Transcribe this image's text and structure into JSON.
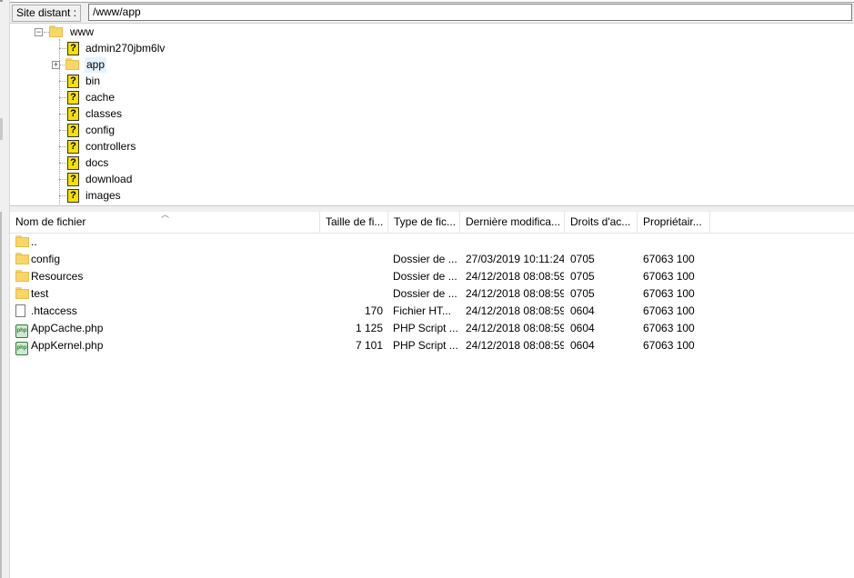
{
  "address": {
    "label": "Site distant :",
    "path": "/www/app"
  },
  "tree": {
    "root": "www",
    "items": [
      {
        "label": "admin270jbm6lv",
        "icon": "question-icon"
      },
      {
        "label": "app",
        "icon": "folder-icon",
        "selected": true,
        "expander": "+"
      },
      {
        "label": "bin",
        "icon": "question-icon"
      },
      {
        "label": "cache",
        "icon": "question-icon"
      },
      {
        "label": "classes",
        "icon": "question-icon"
      },
      {
        "label": "config",
        "icon": "question-icon"
      },
      {
        "label": "controllers",
        "icon": "question-icon"
      },
      {
        "label": "docs",
        "icon": "question-icon"
      },
      {
        "label": "download",
        "icon": "question-icon"
      },
      {
        "label": "images",
        "icon": "question-icon"
      }
    ]
  },
  "list": {
    "columns": [
      "Nom de fichier",
      "Taille de fi...",
      "Type de fic...",
      "Dernière modifica...",
      "Droits d'ac...",
      "Propriétair..."
    ],
    "rows": [
      {
        "icon": "folder-icon",
        "name": "..",
        "size": "",
        "type": "",
        "modified": "",
        "perms": "",
        "owner": ""
      },
      {
        "icon": "folder-icon",
        "name": "config",
        "size": "",
        "type": "Dossier de ...",
        "modified": "27/03/2019 10:11:24",
        "perms": "0705",
        "owner": "67063 100"
      },
      {
        "icon": "folder-icon",
        "name": "Resources",
        "size": "",
        "type": "Dossier de ...",
        "modified": "24/12/2018 08:08:59",
        "perms": "0705",
        "owner": "67063 100"
      },
      {
        "icon": "folder-icon",
        "name": "test",
        "size": "",
        "type": "Dossier de ...",
        "modified": "24/12/2018 08:08:59",
        "perms": "0705",
        "owner": "67063 100"
      },
      {
        "icon": "file-icon",
        "name": ".htaccess",
        "size": "170",
        "type": "Fichier HT...",
        "modified": "24/12/2018 08:08:59",
        "perms": "0604",
        "owner": "67063 100"
      },
      {
        "icon": "php-icon",
        "name": "AppCache.php",
        "size": "1 125",
        "type": "PHP Script ...",
        "modified": "24/12/2018 08:08:59",
        "perms": "0604",
        "owner": "67063 100"
      },
      {
        "icon": "php-icon",
        "name": "AppKernel.php",
        "size": "7 101",
        "type": "PHP Script ...",
        "modified": "24/12/2018 08:08:59",
        "perms": "0604",
        "owner": "67063 100"
      }
    ]
  },
  "colors": {
    "selection": "#e5f3ff",
    "folder": "#fad765",
    "unknown": "#f5e000"
  }
}
